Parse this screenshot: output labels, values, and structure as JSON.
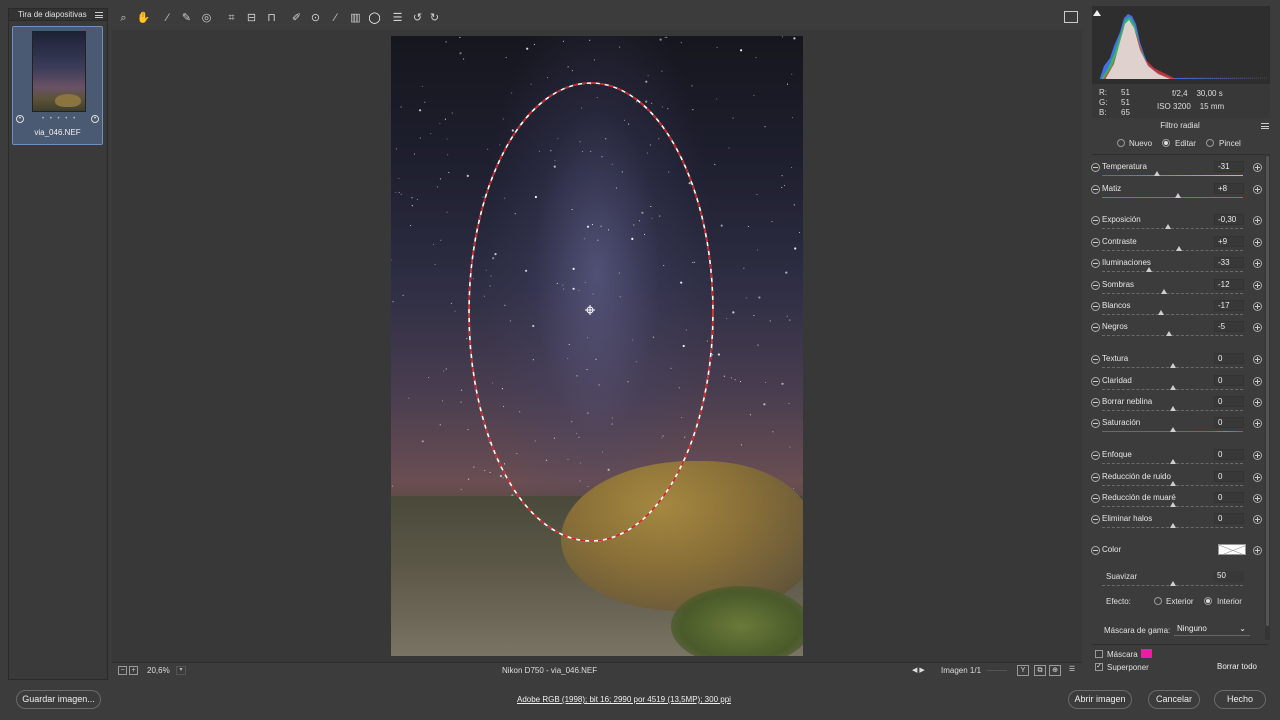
{
  "filmstrip": {
    "title": "Tira de diapositivas",
    "thumbnail": {
      "filename": "via_046.NEF",
      "rating_dots": "• • • • •"
    },
    "icons": [
      "menu-icon"
    ]
  },
  "toolbar": {
    "tools": [
      "zoom-icon",
      "hand-icon",
      "white-balance-icon",
      "color-sampler-icon",
      "target-adjust-icon",
      "crop-icon",
      "straighten-icon",
      "transform-icon",
      "spot-removal-icon",
      "red-eye-icon",
      "adjustment-brush-icon",
      "graduated-filter-icon",
      "radial-filter-icon",
      "presets-icon",
      "rotate-left-icon",
      "rotate-right-icon"
    ],
    "active_tool": "radial-filter-icon"
  },
  "status_bar": {
    "zoom": "20,6%",
    "file_label": "Nikon D750 -  via_046.NEF",
    "image_counter": "Imagen 1/1",
    "view_buttons": [
      "Y",
      "⧉",
      "⊕"
    ]
  },
  "histogram": {
    "readout": {
      "r_label": "R:",
      "r": "51",
      "g_label": "G:",
      "g": "51",
      "b_label": "B:",
      "b": "65"
    },
    "camera_line1": "f/2,4    30,00 s",
    "camera_line2": "ISO 3200    15 mm"
  },
  "panel": {
    "title": "Filtro radial",
    "modes": [
      {
        "label": "Nuevo",
        "selected": false
      },
      {
        "label": "Editar",
        "selected": true
      },
      {
        "label": "Pincel",
        "selected": false
      }
    ],
    "sliders": [
      {
        "label": "Temperatura",
        "value": "-31",
        "fraction": 0.39,
        "style": "grad-temp"
      },
      {
        "label": "Matiz",
        "value": "+8",
        "fraction": 0.54,
        "style": "grad-tint"
      },
      {
        "label": "Exposición",
        "value": "-0,30",
        "fraction": 0.47,
        "style": ""
      },
      {
        "label": "Contraste",
        "value": "+9",
        "fraction": 0.545,
        "style": ""
      },
      {
        "label": "Iluminaciones",
        "value": "-33",
        "fraction": 0.335,
        "style": ""
      },
      {
        "label": "Sombras",
        "value": "-12",
        "fraction": 0.44,
        "style": ""
      },
      {
        "label": "Blancos",
        "value": "-17",
        "fraction": 0.415,
        "style": ""
      },
      {
        "label": "Negros",
        "value": "-5",
        "fraction": 0.475,
        "style": ""
      },
      {
        "label": "Textura",
        "value": "0",
        "fraction": 0.5,
        "style": ""
      },
      {
        "label": "Claridad",
        "value": "0",
        "fraction": 0.5,
        "style": ""
      },
      {
        "label": "Borrar neblina",
        "value": "0",
        "fraction": 0.5,
        "style": ""
      },
      {
        "label": "Saturación",
        "value": "0",
        "fraction": 0.5,
        "style": "grad-sat"
      },
      {
        "label": "Enfoque",
        "value": "0",
        "fraction": 0.5,
        "style": ""
      },
      {
        "label": "Reducción de ruido",
        "value": "0",
        "fraction": 0.5,
        "style": ""
      },
      {
        "label": "Reducción de muaré",
        "value": "0",
        "fraction": 0.5,
        "style": ""
      },
      {
        "label": "Eliminar halos",
        "value": "0",
        "fraction": 0.5,
        "style": ""
      }
    ],
    "color_label": "Color",
    "smooth": {
      "label": "Suavizar",
      "value": "50",
      "fraction": 0.5
    },
    "effect": {
      "label": "Efecto:",
      "options": [
        {
          "label": "Exterior",
          "selected": false
        },
        {
          "label": "Interior",
          "selected": true
        }
      ]
    },
    "gamut": {
      "label": "Máscara de gama:",
      "value": "Ninguno"
    },
    "mask": {
      "label": "Máscara",
      "checked": false,
      "color": "#e81ea6"
    },
    "overlay": {
      "label": "Superponer",
      "checked": true
    },
    "clear_all": "Borrar todo"
  },
  "footer": {
    "save": "Guardar imagen...",
    "workflow": "Adobe RGB (1998); bit 16; 2990 por 4519 (13,5MP); 300 ppi",
    "open": "Abrir imagen",
    "cancel": "Cancelar",
    "done": "Hecho"
  },
  "colors": {
    "accent_selection": "#6f8fbf",
    "mask_overlay": "#e81ea6",
    "ellipse_stroke": "#ffffff",
    "ellipse_dash": "#d02020"
  }
}
